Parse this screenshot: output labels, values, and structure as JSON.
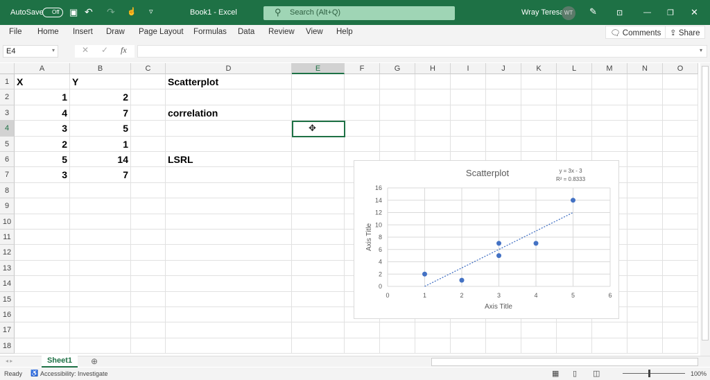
{
  "titlebar": {
    "autosave": "AutoSave",
    "autosave_state": "Off",
    "title": "Book1 - Excel",
    "search_placeholder": "Search (Alt+Q)",
    "user": "Wray Teresa",
    "initials": "WT"
  },
  "menu": [
    "File",
    "Home",
    "Insert",
    "Draw",
    "Page Layout",
    "Formulas",
    "Data",
    "Review",
    "View",
    "Help"
  ],
  "comments": "Comments",
  "share": "Share",
  "namebox": "E4",
  "fx": "fx",
  "columns": [
    "A",
    "B",
    "C",
    "D",
    "E",
    "F",
    "G",
    "H",
    "I",
    "J",
    "K",
    "L",
    "M",
    "N",
    "O"
  ],
  "rows": [
    "1",
    "2",
    "3",
    "4",
    "5",
    "6",
    "7",
    "8",
    "9",
    "10",
    "11",
    "12",
    "13",
    "14",
    "15",
    "16",
    "17",
    "18"
  ],
  "cells": [
    {
      "ref": "A1",
      "v": "X"
    },
    {
      "ref": "B1",
      "v": "Y"
    },
    {
      "ref": "D1",
      "v": "Scatterplot"
    },
    {
      "ref": "A2",
      "v": "1",
      "n": true
    },
    {
      "ref": "B2",
      "v": "2",
      "n": true
    },
    {
      "ref": "A3",
      "v": "4",
      "n": true
    },
    {
      "ref": "B3",
      "v": "7",
      "n": true
    },
    {
      "ref": "D3",
      "v": "correlation"
    },
    {
      "ref": "A4",
      "v": "3",
      "n": true
    },
    {
      "ref": "B4",
      "v": "5",
      "n": true
    },
    {
      "ref": "A5",
      "v": "2",
      "n": true
    },
    {
      "ref": "B5",
      "v": "1",
      "n": true
    },
    {
      "ref": "A6",
      "v": "5",
      "n": true
    },
    {
      "ref": "B6",
      "v": "14",
      "n": true
    },
    {
      "ref": "D6",
      "v": "LSRL"
    },
    {
      "ref": "A7",
      "v": "3",
      "n": true
    },
    {
      "ref": "B7",
      "v": "7",
      "n": true
    }
  ],
  "sheet_tab": "Sheet1",
  "status": {
    "ready": "Ready",
    "accessibility": "Accessibility: Investigate",
    "zoom": "100%"
  },
  "chart_data": {
    "type": "scatter",
    "title": "Scatterplot",
    "xlabel": "Axis Title",
    "ylabel": "Axis Title",
    "x": [
      1,
      4,
      3,
      2,
      5,
      3
    ],
    "y": [
      2,
      7,
      5,
      1,
      14,
      7
    ],
    "xlim": [
      0,
      6
    ],
    "ylim": [
      0,
      16
    ],
    "xticks": [
      0,
      1,
      2,
      3,
      4,
      5,
      6
    ],
    "yticks": [
      0,
      2,
      4,
      6,
      8,
      10,
      12,
      14,
      16
    ],
    "trendline": {
      "slope": 3,
      "intercept": -3,
      "equation": "y = 3x - 3",
      "r2": "R² = 0.8333",
      "x_range": [
        1,
        5
      ]
    },
    "color": "#4472c4",
    "grid": true
  }
}
